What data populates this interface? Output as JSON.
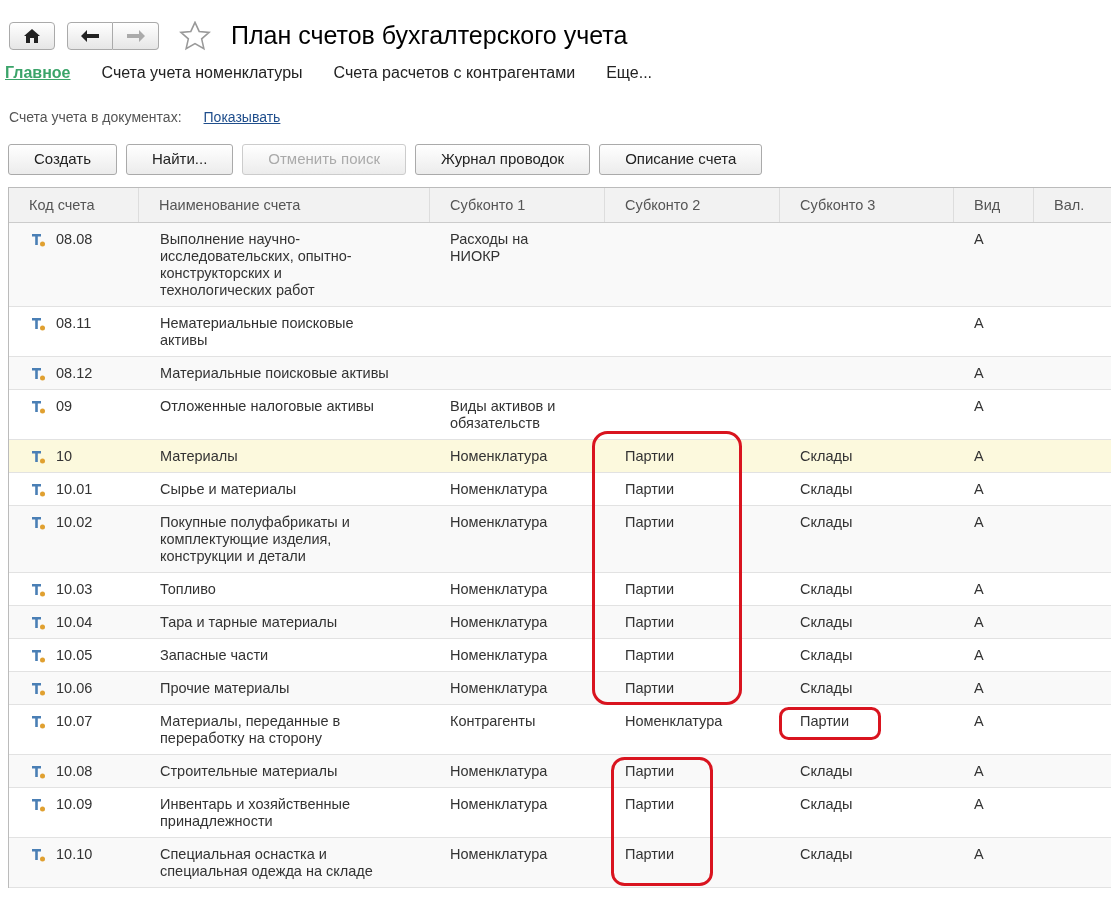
{
  "window": {
    "title": "План счетов бухгалтерского учета",
    "favorite": false
  },
  "tabs": [
    {
      "label": "Главное",
      "selected": true
    },
    {
      "label": "Счета учета номенклатуры",
      "selected": false
    },
    {
      "label": "Счета расчетов с контрагентами",
      "selected": false
    },
    {
      "label": "Еще...",
      "selected": false
    }
  ],
  "setting": {
    "label": "Счета учета в документах:",
    "link": "Показывать"
  },
  "buttons": [
    {
      "label": "Создать",
      "disabled": false
    },
    {
      "label": "Найти...",
      "disabled": false
    },
    {
      "label": "Отменить поиск",
      "disabled": true
    },
    {
      "label": "Журнал проводок",
      "disabled": false
    },
    {
      "label": "Описание счета",
      "disabled": false
    }
  ],
  "table": {
    "columns": [
      "Код счета",
      "Наименование счета",
      "Субконто 1",
      "Субконто 2",
      "Субконто 3",
      "Вид",
      "Вал."
    ],
    "rows": [
      {
        "code": "08.08",
        "name": "Выполнение научно-исследовательских, опытно-конструкторских и технологических работ",
        "sub1": "Расходы на НИОКР",
        "sub2": "",
        "sub3": "",
        "kind": "А",
        "selected": false
      },
      {
        "code": "08.11",
        "name": "Нематериальные поисковые активы",
        "sub1": "",
        "sub2": "",
        "sub3": "",
        "kind": "А",
        "selected": false
      },
      {
        "code": "08.12",
        "name": "Материальные поисковые активы",
        "sub1": "",
        "sub2": "",
        "sub3": "",
        "kind": "А",
        "selected": false
      },
      {
        "code": "09",
        "name": "Отложенные налоговые активы",
        "sub1": "Виды активов и обязательств",
        "sub2": "",
        "sub3": "",
        "kind": "А",
        "selected": false
      },
      {
        "code": "10",
        "name": "Материалы",
        "sub1": "Номенклатура",
        "sub2": "Партии",
        "sub3": "Склады",
        "kind": "А",
        "selected": true
      },
      {
        "code": "10.01",
        "name": "Сырье и материалы",
        "sub1": "Номенклатура",
        "sub2": "Партии",
        "sub3": "Склады",
        "kind": "А",
        "selected": false
      },
      {
        "code": "10.02",
        "name": "Покупные полуфабрикаты и комплектующие изделия, конструкции и детали",
        "sub1": "Номенклатура",
        "sub2": "Партии",
        "sub3": "Склады",
        "kind": "А",
        "selected": false
      },
      {
        "code": "10.03",
        "name": "Топливо",
        "sub1": "Номенклатура",
        "sub2": "Партии",
        "sub3": "Склады",
        "kind": "А",
        "selected": false
      },
      {
        "code": "10.04",
        "name": "Тара и тарные материалы",
        "sub1": "Номенклатура",
        "sub2": "Партии",
        "sub3": "Склады",
        "kind": "А",
        "selected": false
      },
      {
        "code": "10.05",
        "name": "Запасные части",
        "sub1": "Номенклатура",
        "sub2": "Партии",
        "sub3": "Склады",
        "kind": "А",
        "selected": false
      },
      {
        "code": "10.06",
        "name": "Прочие материалы",
        "sub1": "Номенклатура",
        "sub2": "Партии",
        "sub3": "Склады",
        "kind": "А",
        "selected": false
      },
      {
        "code": "10.07",
        "name": "Материалы, переданные в переработку на сторону",
        "sub1": "Контрагенты",
        "sub2": "Номенклатура",
        "sub3": "Партии",
        "kind": "А",
        "selected": false
      },
      {
        "code": "10.08",
        "name": "Строительные материалы",
        "sub1": "Номенклатура",
        "sub2": "Партии",
        "sub3": "Склады",
        "kind": "А",
        "selected": false
      },
      {
        "code": "10.09",
        "name": "Инвентарь и хозяйственные принадлежности",
        "sub1": "Номенклатура",
        "sub2": "Партии",
        "sub3": "Склады",
        "kind": "А",
        "selected": false
      },
      {
        "code": "10.10",
        "name": "Специальная оснастка и специальная одежда на складе",
        "sub1": "Номенклатура",
        "sub2": "Партии",
        "sub3": "Склады",
        "kind": "А",
        "selected": false
      }
    ]
  }
}
